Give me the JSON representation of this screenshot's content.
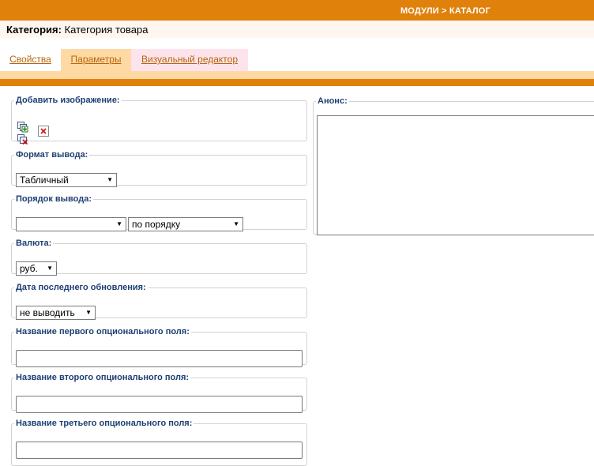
{
  "header": {
    "breadcrumb": "МОДУЛИ > КАТАЛОГ"
  },
  "category": {
    "label": "Категория:",
    "value": "Категория товара"
  },
  "tabs": [
    {
      "label": "Свойства",
      "active": false
    },
    {
      "label": "Параметры",
      "active": true
    },
    {
      "label": "Визуальный редактор",
      "active": false
    }
  ],
  "fields": {
    "add_image": {
      "legend": "Добавить изображение:"
    },
    "output_format": {
      "legend": "Формат вывода:",
      "value": "Табличный"
    },
    "output_order": {
      "legend": "Порядок вывода:",
      "value1": "",
      "value2": "по порядку"
    },
    "currency": {
      "legend": "Валюта:",
      "value": "руб."
    },
    "last_update": {
      "legend": "Дата последнего обновления:",
      "value": "не выводить"
    },
    "opt1": {
      "legend": "Название первого опционального поля:",
      "value": ""
    },
    "opt2": {
      "legend": "Название второго опционального поля:",
      "value": ""
    },
    "opt3": {
      "legend": "Название третьего опционального поля:",
      "value": ""
    },
    "announce": {
      "legend": "Анонс:",
      "value": ""
    }
  },
  "colors": {
    "accent": "#e0810c",
    "tab_active": "#ffd9a4",
    "legend": "#1d3f73",
    "link": "#b5650c"
  }
}
